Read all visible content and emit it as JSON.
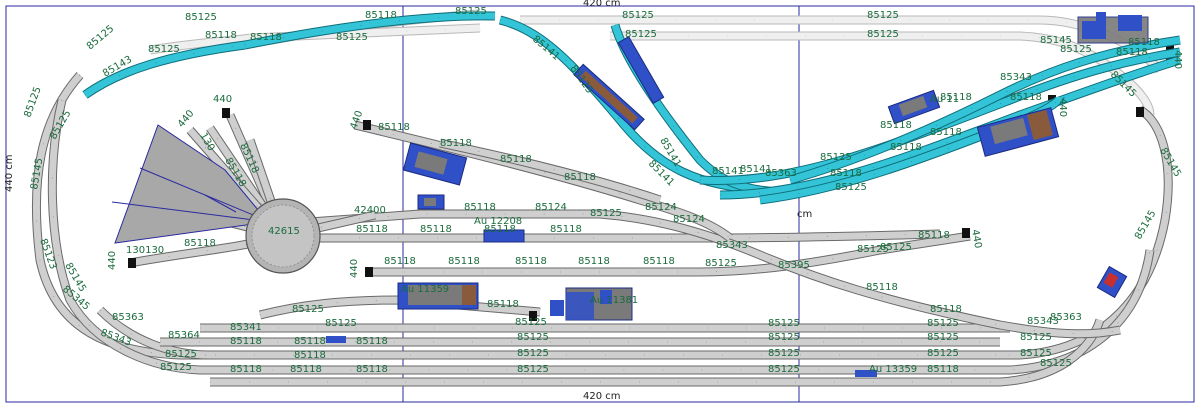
{
  "dimensions": {
    "top": "420 cm",
    "bottom": "420 cm",
    "left": "440 cm",
    "middle": "cm"
  },
  "turntable_label": "42615",
  "bumper_labels": [
    "440",
    "440",
    "440",
    "440",
    "440",
    "440",
    "440",
    "440"
  ],
  "dual_labels": [
    "130130"
  ],
  "track_labels": {
    "t85125": "85125",
    "t85118": "85118",
    "t85143": "85143",
    "t85141": "85141",
    "t85145": "85145",
    "t85124": "85124",
    "t85343": "85343",
    "t85363": "85363",
    "t85364": "85364",
    "t85341": "85341",
    "t85342": "85342",
    "t85345": "85345",
    "t42400": "42400",
    "t130": "130"
  },
  "accessory_labels": [
    "Au 12208",
    "Au 11359",
    "Au 11381",
    "Au 13359",
    "Au 11"
  ],
  "colors": {
    "background": "#ffffff",
    "border": "#2a2aa0",
    "track_fill": "#cfcfcf",
    "track_edge": "#6a6a6a",
    "upper_level_fill": "#33c4d8",
    "upper_level_edge": "#0f6e7a",
    "ghost_fill": "#efefef",
    "ghost_edge": "#b8b8b8",
    "label": "#1a6b3c",
    "building_blue": "#3050c8",
    "building_grey": "#7a7a7a",
    "building_brown": "#8a5a3c",
    "turntable": "#b0b0b0",
    "fan": "#a8a8a8"
  }
}
